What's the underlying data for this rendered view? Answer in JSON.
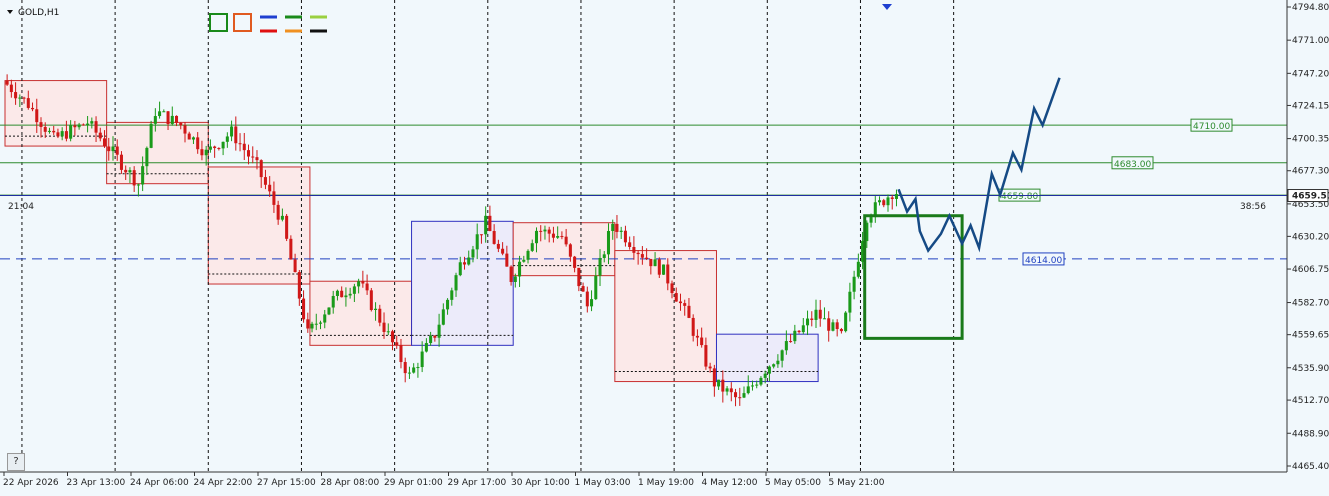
{
  "symbol_label": "GOLD,H1",
  "time_left_label": "21:04",
  "time_right_label": "38:56",
  "help_button": "?",
  "colors": {
    "background": "#f1f8fc",
    "bull": "#1a9a1a",
    "bear": "#d01818",
    "level_line": "#2e8b2e",
    "forecast": "#154a85",
    "current_price": "#1f2ea0"
  },
  "toolbar_swatches": [
    {
      "type": "box",
      "color": "#1a8a1a"
    },
    {
      "type": "box",
      "color": "#e05a20"
    },
    {
      "type": "line",
      "color": "#1f3fd0"
    },
    {
      "type": "line",
      "color": "#1a8a1a"
    },
    {
      "type": "line",
      "color": "#9ad040"
    },
    {
      "type": "line",
      "color": "#e01010"
    },
    {
      "type": "line",
      "color": "#f09020"
    },
    {
      "type": "line",
      "color": "#111111"
    }
  ],
  "chart_data": {
    "type": "candlestick",
    "symbol": "GOLD",
    "timeframe": "H1",
    "ylim": [
      4465.4,
      4794.8
    ],
    "y_ticks": [
      "4794.80",
      "4771.00",
      "4747.20",
      "4724.15",
      "4700.35",
      "4677.30",
      "4653.50",
      "4630.20",
      "4606.75",
      "4582.70",
      "4559.65",
      "4535.90",
      "4512.70",
      "4488.90",
      "4465.40"
    ],
    "x_ticks": [
      "22 Apr 2026",
      "23 Apr 13:00",
      "24 Apr 06:00",
      "24 Apr 22:00",
      "27 Apr 15:00",
      "28 Apr 08:00",
      "29 Apr 01:00",
      "29 Apr 17:00",
      "30 Apr 10:00",
      "1 May 03:00",
      "1 May 19:00",
      "4 May 12:00",
      "5 May 05:00",
      "5 May 21:00"
    ],
    "current_price": "4659.51",
    "levels": [
      {
        "value": 4710.0,
        "label": "4710.00",
        "style": "solid"
      },
      {
        "value": 4683.0,
        "label": "4683.00",
        "style": "solid"
      },
      {
        "value": 4659.8,
        "label": "4659.80",
        "style": "solid"
      },
      {
        "value": 4614.0,
        "label": "4614.00",
        "style": "dashed"
      }
    ],
    "anchors": [
      {
        "i": 0,
        "p": 4742
      },
      {
        "i": 6,
        "p": 4725
      },
      {
        "i": 12,
        "p": 4700
      },
      {
        "i": 20,
        "p": 4712
      },
      {
        "i": 26,
        "p": 4690
      },
      {
        "i": 32,
        "p": 4668
      },
      {
        "i": 36,
        "p": 4720
      },
      {
        "i": 42,
        "p": 4710
      },
      {
        "i": 48,
        "p": 4690
      },
      {
        "i": 54,
        "p": 4705
      },
      {
        "i": 60,
        "p": 4680
      },
      {
        "i": 66,
        "p": 4640
      },
      {
        "i": 72,
        "p": 4560
      },
      {
        "i": 78,
        "p": 4585
      },
      {
        "i": 84,
        "p": 4598
      },
      {
        "i": 90,
        "p": 4565
      },
      {
        "i": 96,
        "p": 4530
      },
      {
        "i": 102,
        "p": 4560
      },
      {
        "i": 108,
        "p": 4610
      },
      {
        "i": 114,
        "p": 4640
      },
      {
        "i": 120,
        "p": 4600
      },
      {
        "i": 126,
        "p": 4635
      },
      {
        "i": 132,
        "p": 4630
      },
      {
        "i": 138,
        "p": 4580
      },
      {
        "i": 144,
        "p": 4640
      },
      {
        "i": 150,
        "p": 4620
      },
      {
        "i": 156,
        "p": 4605
      },
      {
        "i": 162,
        "p": 4570
      },
      {
        "i": 168,
        "p": 4525
      },
      {
        "i": 174,
        "p": 4512
      },
      {
        "i": 180,
        "p": 4535
      },
      {
        "i": 186,
        "p": 4555
      },
      {
        "i": 192,
        "p": 4575
      },
      {
        "i": 198,
        "p": 4558
      },
      {
        "i": 204,
        "p": 4645
      },
      {
        "i": 210,
        "p": 4662
      }
    ],
    "sessions": [
      {
        "from": 0,
        "to": 23,
        "high": 4742,
        "low": 4695,
        "dir": "bear"
      },
      {
        "from": 24,
        "to": 47,
        "high": 4712,
        "low": 4668,
        "dir": "bear"
      },
      {
        "from": 48,
        "to": 71,
        "high": 4680,
        "low": 4596,
        "dir": "bear"
      },
      {
        "from": 72,
        "to": 95,
        "high": 4598,
        "low": 4552,
        "dir": "bear"
      },
      {
        "from": 96,
        "to": 119,
        "high": 4641,
        "low": 4552,
        "dir": "bull"
      },
      {
        "from": 120,
        "to": 143,
        "high": 4640,
        "low": 4602,
        "dir": "bear"
      },
      {
        "from": 144,
        "to": 167,
        "high": 4620,
        "low": 4526,
        "dir": "bear"
      },
      {
        "from": 168,
        "to": 191,
        "high": 4560,
        "low": 4526,
        "dir": "bull"
      }
    ],
    "forecast_box": {
      "from_bar": 203,
      "to_bar": 226,
      "top": 4645,
      "bottom": 4557
    },
    "forecast_path": [
      {
        "bar": 211,
        "p": 4664
      },
      {
        "bar": 213,
        "p": 4648
      },
      {
        "bar": 215,
        "p": 4657
      },
      {
        "bar": 216,
        "p": 4634
      },
      {
        "bar": 218,
        "p": 4620
      },
      {
        "bar": 221,
        "p": 4632
      },
      {
        "bar": 223,
        "p": 4645
      },
      {
        "bar": 226,
        "p": 4625
      },
      {
        "bar": 228,
        "p": 4638
      },
      {
        "bar": 230,
        "p": 4622
      },
      {
        "bar": 233,
        "p": 4675
      },
      {
        "bar": 235,
        "p": 4660
      },
      {
        "bar": 238,
        "p": 4690
      },
      {
        "bar": 240,
        "p": 4678
      },
      {
        "bar": 243,
        "p": 4722
      },
      {
        "bar": 245,
        "p": 4710
      },
      {
        "bar": 249,
        "p": 4744
      }
    ]
  }
}
